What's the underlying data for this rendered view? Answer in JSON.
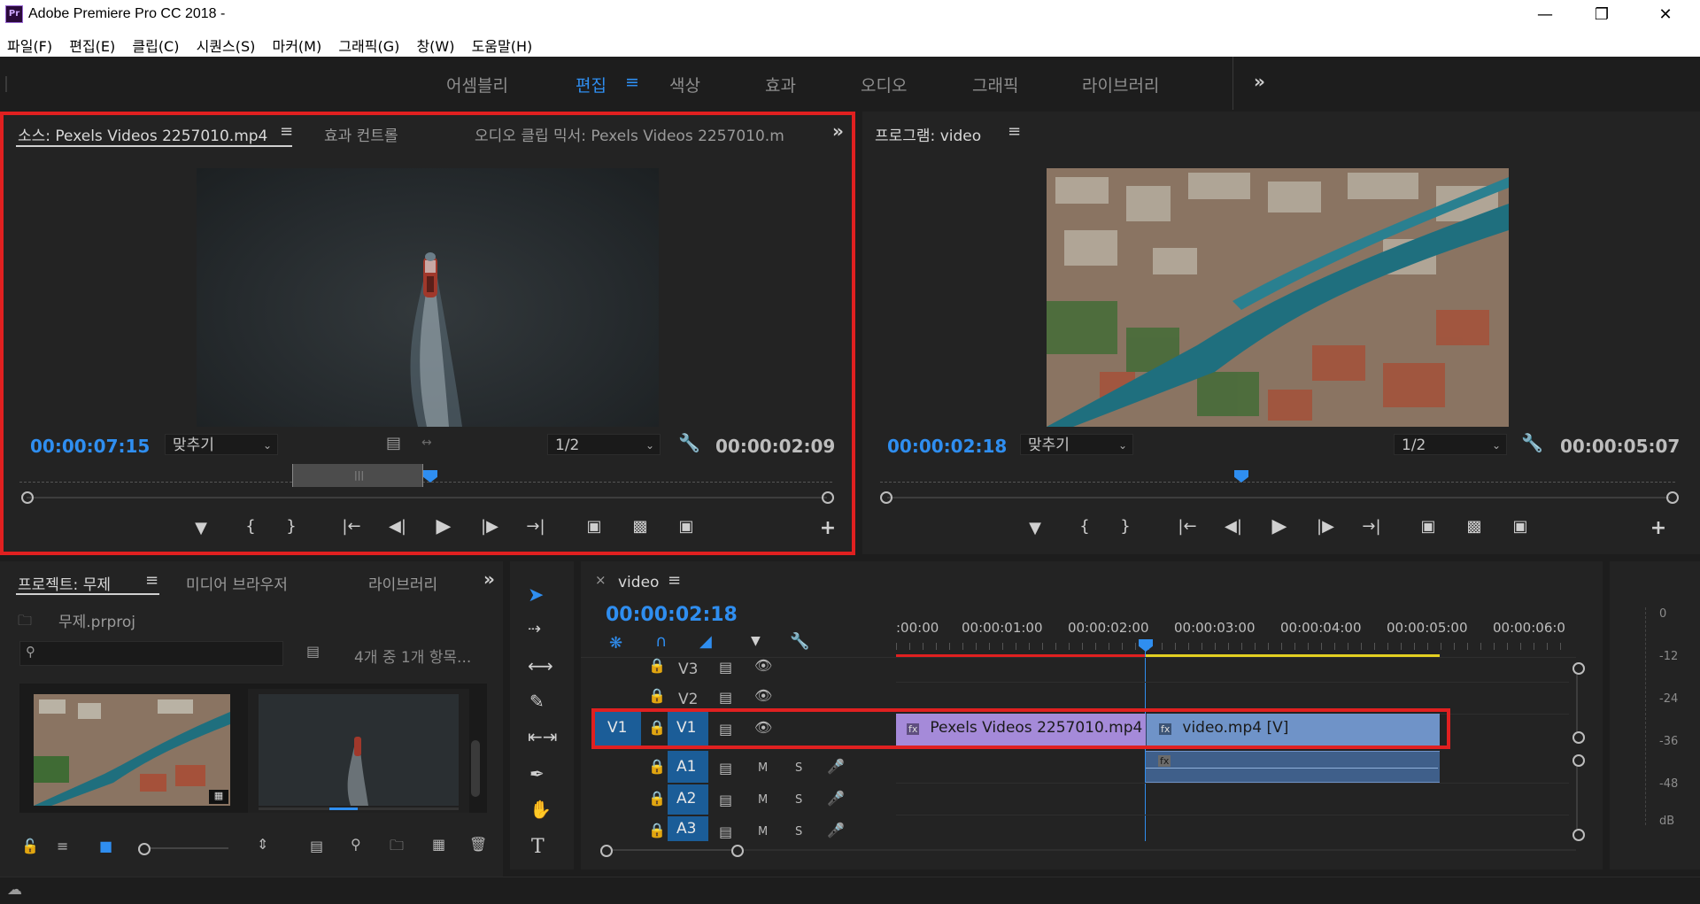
{
  "app": {
    "icon_text": "Pr",
    "title": "Adobe Premiere Pro CC 2018 -",
    "window_controls": [
      "minimize-icon",
      "restore-icon",
      "close-icon"
    ]
  },
  "menu": [
    "파일(F)",
    "편집(E)",
    "클립(C)",
    "시퀀스(S)",
    "마커(M)",
    "그래픽(G)",
    "창(W)",
    "도움말(H)"
  ],
  "workspaces": {
    "items": [
      "어셈블리",
      "편집",
      "색상",
      "효과",
      "오디오",
      "그래픽",
      "라이브러리"
    ],
    "active": "편집",
    "more": "»"
  },
  "source_panel": {
    "tab_source": "소스: Pexels Videos 2257010.mp4",
    "tab_effects": "효과 컨트롤",
    "tab_audio_mixer": "오디오 클립 믹서: Pexels Videos 2257010.m",
    "current_time": "00:00:07:15",
    "zoom": "맞추기",
    "resolution": "1/2",
    "duration": "00:00:02:09",
    "playhead_fraction": 0.5,
    "icons": [
      "marker-icon",
      "mark-in-icon",
      "mark-out-icon",
      "go-to-in-icon",
      "step-back-icon",
      "play-icon",
      "step-forward-icon",
      "go-to-out-icon",
      "insert-icon",
      "overwrite-icon",
      "camera-icon",
      "add-icon"
    ]
  },
  "program_panel": {
    "tab": "프로그램: video",
    "current_time": "00:00:02:18",
    "zoom": "맞추기",
    "resolution": "1/2",
    "duration": "00:00:05:07",
    "playhead_fraction": 0.45
  },
  "project_panel": {
    "tab_project": "프로젝트: 무제",
    "tab_media_browser": "미디어 브라우저",
    "tab_libraries": "라이브러리",
    "file_name": "무제.prproj",
    "item_count": "4개 중 1개 항목...",
    "search_placeholder": ""
  },
  "timeline": {
    "sequence_name": "video",
    "close": "×",
    "current_time": "00:00:02:18",
    "ruler": [
      ":00:00",
      "00:00:01:00",
      "00:00:02:00",
      "00:00:03:00",
      "00:00:04:00",
      "00:00:05:00",
      "00:00:06:0"
    ],
    "video_tracks": [
      "V3",
      "V2",
      "V1"
    ],
    "audio_tracks": [
      "A1",
      "A2",
      "A3"
    ],
    "source_patch_v": "V1",
    "m_label": "M",
    "s_label": "S",
    "clip1": "Pexels Videos 2257010.mp4",
    "clip2": "video.mp4 [V]",
    "fx": "fx"
  },
  "audio_meter": {
    "labels": [
      "0",
      "-12",
      "-24",
      "-36",
      "-48",
      "dB"
    ]
  },
  "colors": {
    "accent": "#2f8ef0",
    "highlight": "#e02020",
    "clip_purple": "#a58ad9",
    "clip_blue": "#6f93c8",
    "panel_bg": "#232323"
  }
}
